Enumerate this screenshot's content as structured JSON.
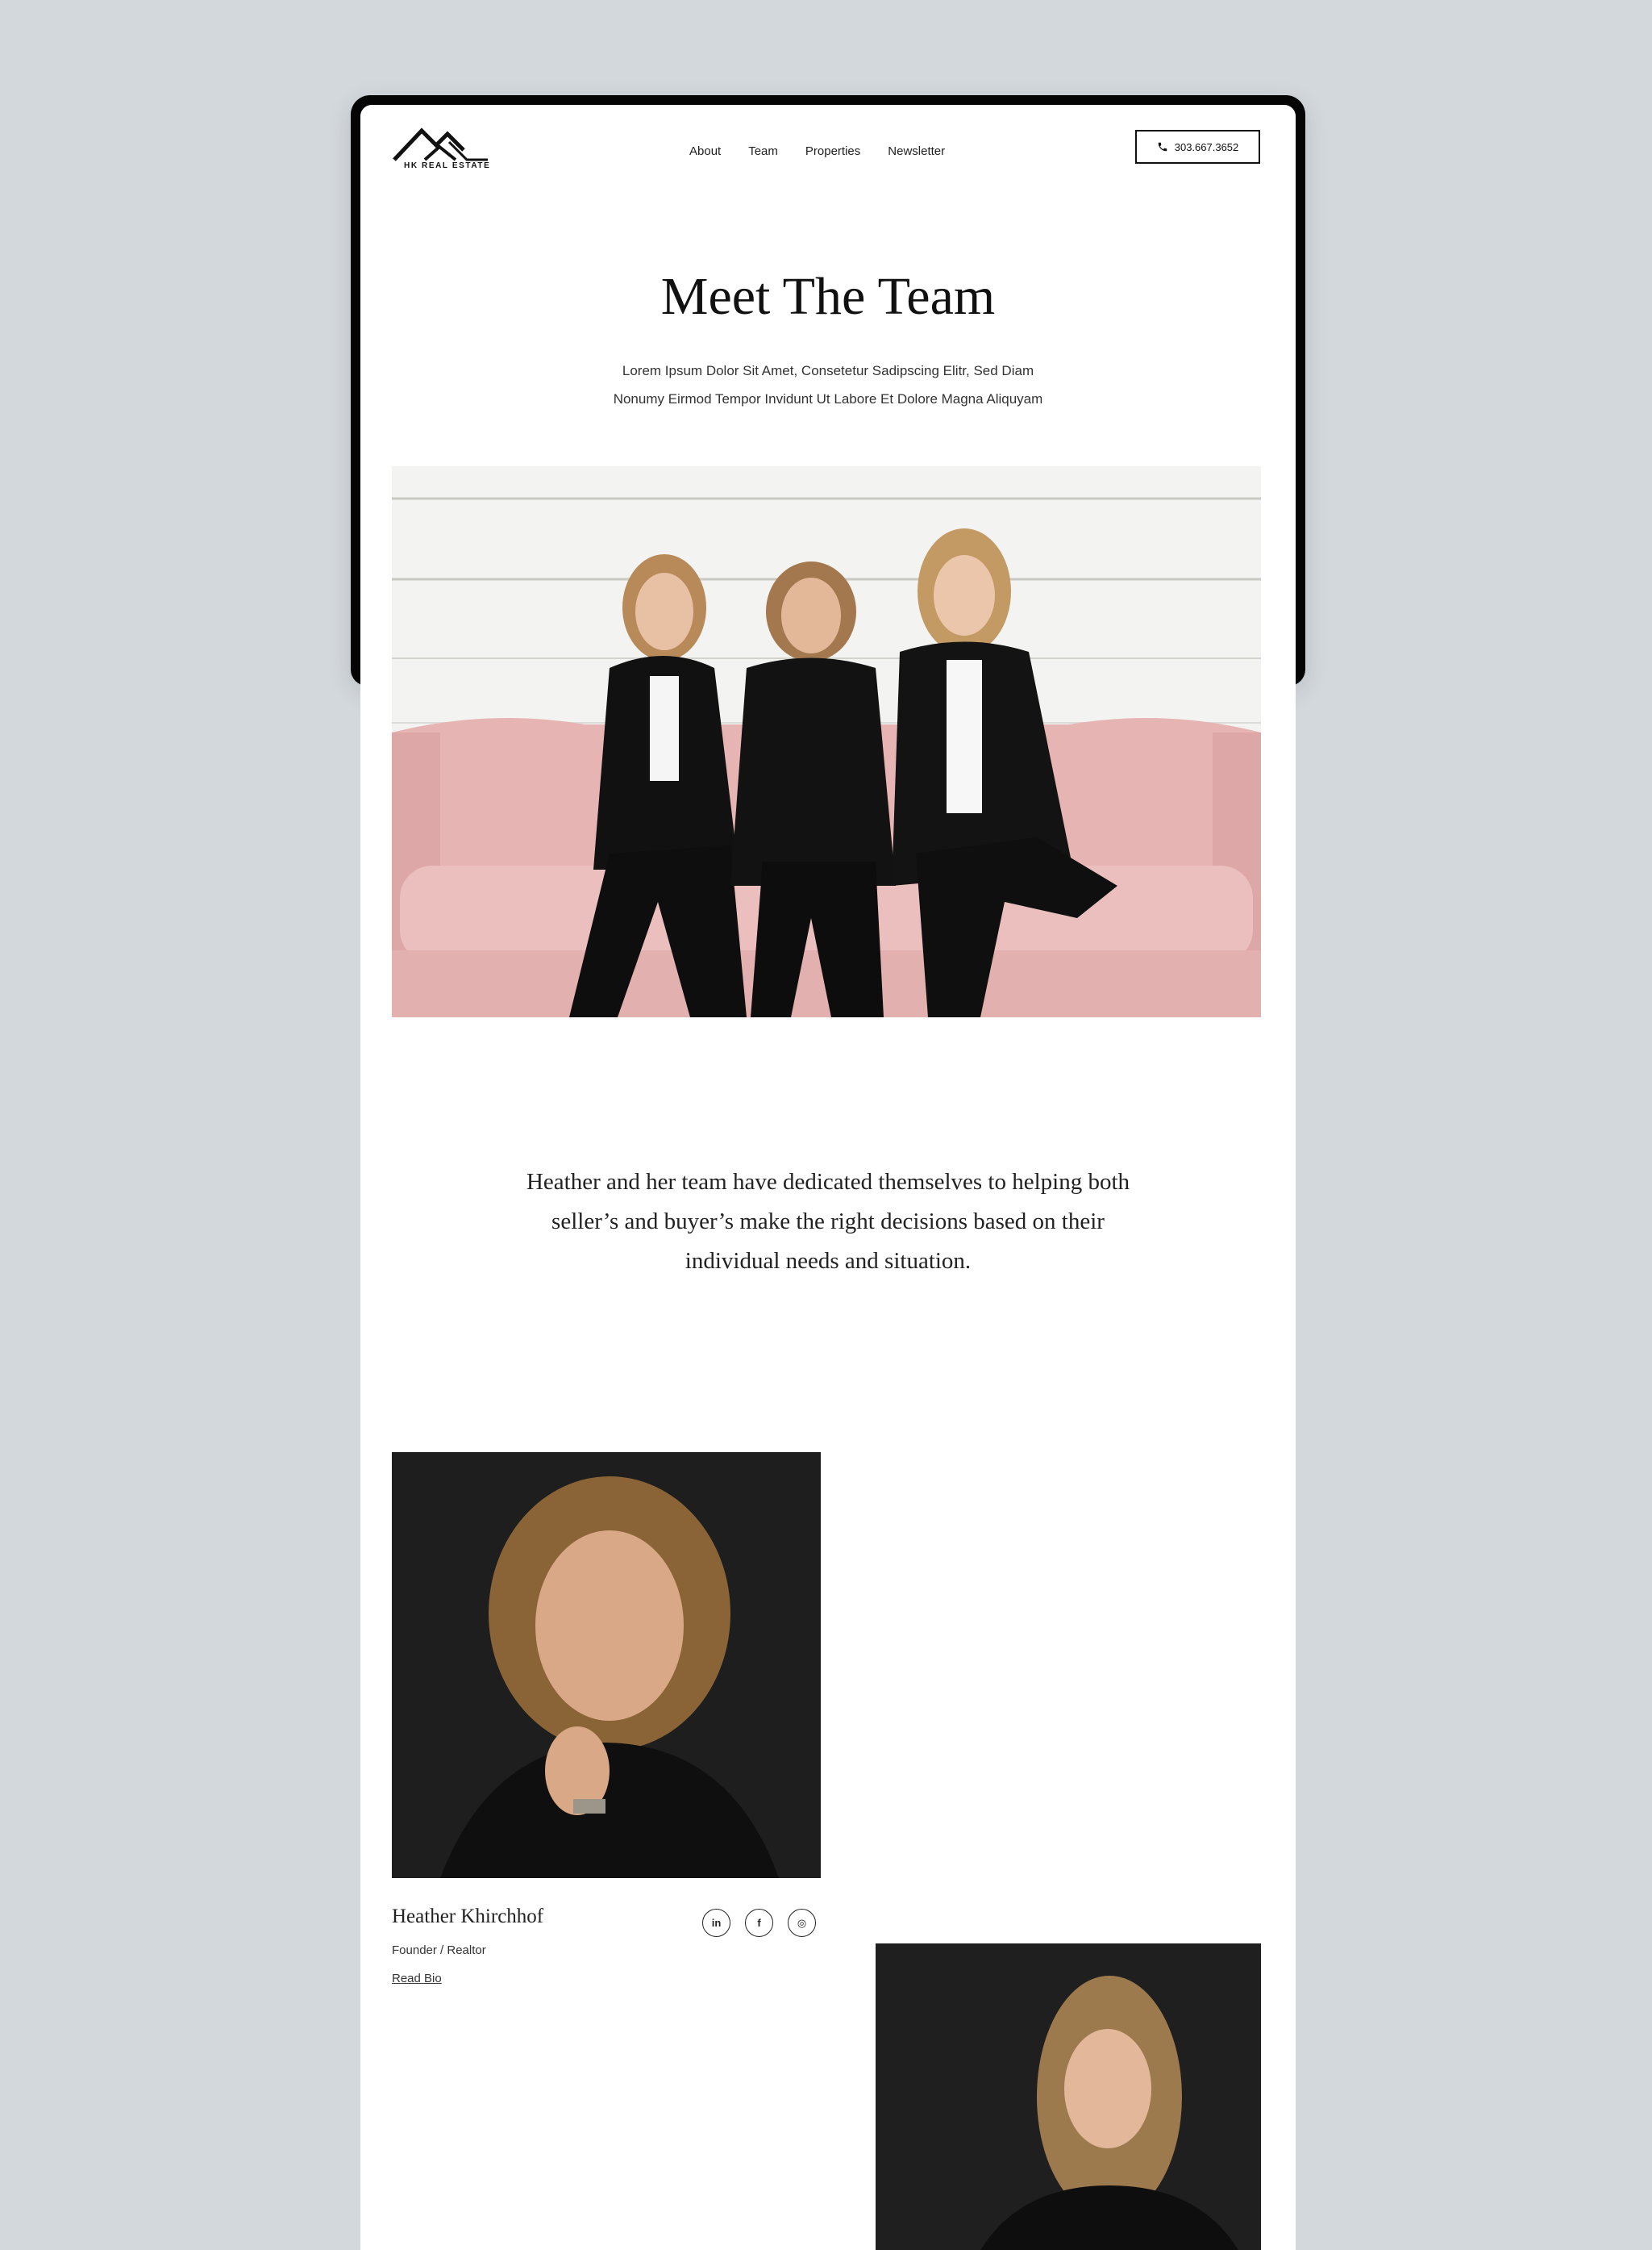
{
  "brand": {
    "logo_text": "HK REAL ESTATE"
  },
  "nav": {
    "items": [
      "About",
      "Team",
      "Properties",
      "Newsletter"
    ]
  },
  "header": {
    "phone": "303.667.3652",
    "phone_icon": "phone-icon"
  },
  "hero": {
    "title": "Meet The Team",
    "subtitle_line1": "Lorem Ipsum Dolor Sit Amet, Consetetur Sadipscing Elitr, Sed Diam",
    "subtitle_line2": "Nonumy Eirmod Tempor Invidunt Ut Labore Et Dolore Magna Aliquyam"
  },
  "quote": {
    "text": "Heather and her team have dedicated themselves to helping both seller’s and buyer’s make the right decisions based on their individual needs and situation."
  },
  "members": [
    {
      "name": "Heather Khirchhof",
      "role": "Founder / Realtor",
      "link": "Read Bio",
      "socials": [
        {
          "icon": "linkedin-icon",
          "glyph": "in"
        },
        {
          "icon": "facebook-icon",
          "glyph": "f"
        },
        {
          "icon": "instagram-icon",
          "glyph": "◎"
        }
      ]
    }
  ],
  "colors": {
    "background": "#d3d8dc",
    "frame": "#050505",
    "page": "#ffffff",
    "text": "#1a1a1a",
    "sofa": "#e8b7b6",
    "suit": "#111111"
  }
}
